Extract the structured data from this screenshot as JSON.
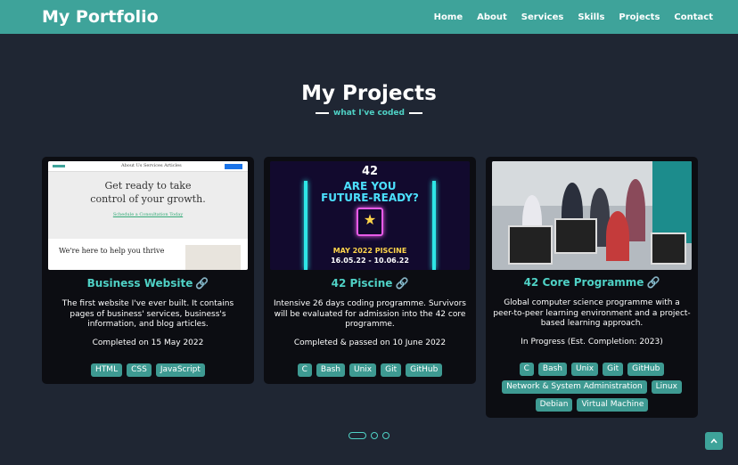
{
  "navbar": {
    "brand": "My Portfolio",
    "links": [
      "Home",
      "About",
      "Services",
      "Skills",
      "Projects",
      "Contact"
    ]
  },
  "section": {
    "title": "My Projects",
    "subtitle": "what I've coded"
  },
  "projects": [
    {
      "title": "Business Website",
      "link_icon": "🔗",
      "description": "The first website I've ever built. It contains pages of business' services, business's information, and blog articles.",
      "status": "Completed on 15 May 2022",
      "tags": [
        "HTML",
        "CSS",
        "JavaScript"
      ],
      "thumb": {
        "menu": "About Us    Services    Articles",
        "hero_line1": "Get ready to take",
        "hero_line2": "control of your growth.",
        "hero_link": "Schedule a Consultation Today",
        "help": "We're here to help you thrive"
      }
    },
    {
      "title": "42 Piscine",
      "link_icon": "🔗",
      "description": "Intensive 26 days coding programme. Survivors will be evaluated for admission into the 42 core programme.",
      "status": "Completed & passed on 10 June 2022",
      "tags": [
        "C",
        "Bash",
        "Unix",
        "Git",
        "GitHub"
      ],
      "thumb": {
        "logo": "42",
        "headline1": "ARE YOU",
        "headline2": "FUTURE-READY?",
        "event": "MAY 2022 PISCINE",
        "dates": "16.05.22 - 10.06.22"
      }
    },
    {
      "title": "42 Core Programme",
      "link_icon": "🔗",
      "description": "Global computer science programme with a peer-to-peer learning environment and a project-based learning approach.",
      "status": "In Progress (Est. Completion: 2023)",
      "tags": [
        "C",
        "Bash",
        "Unix",
        "Git",
        "GitHub",
        "Network & System Administration",
        "Linux",
        "Debian",
        "Virtual Machine"
      ]
    }
  ],
  "pagination": {
    "pages": 3,
    "active": 0
  },
  "scroll_top_icon": "chevron-up-icon",
  "colors": {
    "accent": "#3ea39a",
    "title_accent": "#4fd1c5",
    "background": "#1f2633",
    "card": "#0c0d12"
  }
}
